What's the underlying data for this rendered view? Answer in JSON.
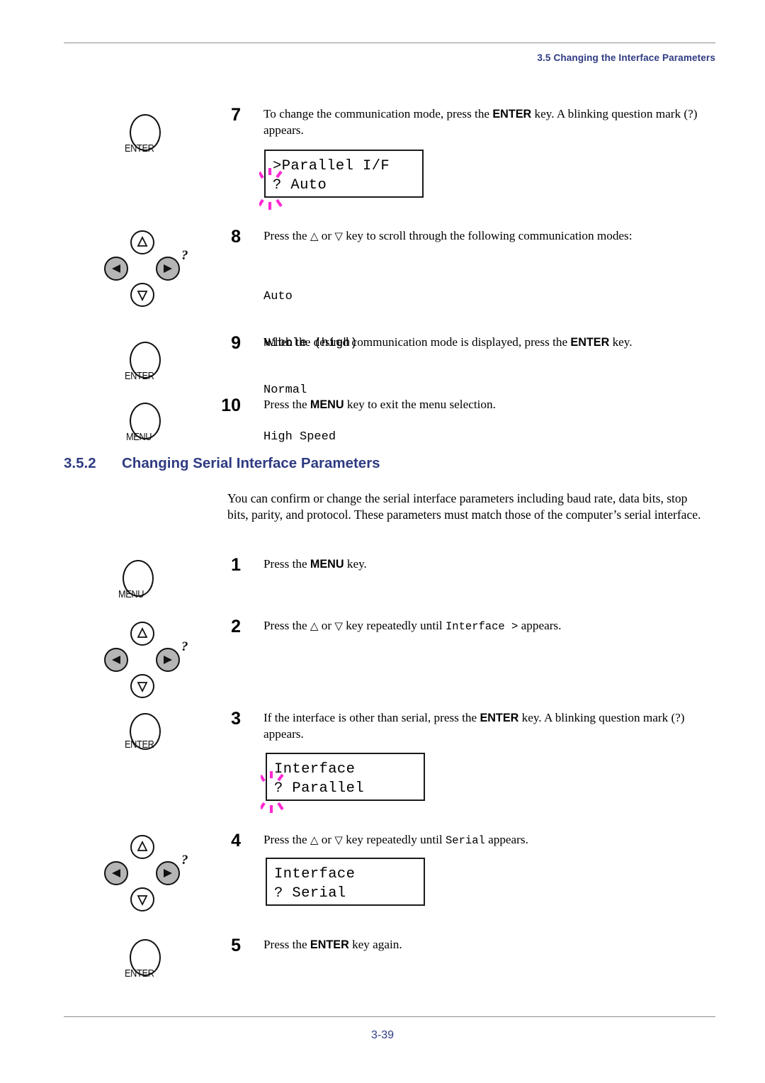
{
  "header": {
    "title": "3.5 Changing the Interface Parameters"
  },
  "footer": {
    "page_number": "3-39"
  },
  "section": {
    "number": "3.5.2",
    "title": "Changing Serial Interface Parameters",
    "intro": "You can confirm or change the serial interface parameters including baud rate, data bits, stop bits, parity, and protocol. These parameters must match those of the computer’s serial interface."
  },
  "key_icons": {
    "enter_label": "ENTER",
    "menu_label": "MENU",
    "question_mark": "?"
  },
  "colors": {
    "heading_navy": "#2e3b82",
    "blink_magenta": "#ff2ad4",
    "rule_gray": "#8d8d8d",
    "key_fill_gray": "#b5b5b5"
  },
  "steps": [
    {
      "number": "7",
      "text_html": "To change the communication mode, press the <b>ENTER</b> key. A blinking question mark (?) appears."
    },
    {
      "number": "8",
      "text_html": "Press the <span class=\"tri\">△</span> or <span class=\"tri\">▽</span> key to scroll through the following communication modes:"
    },
    {
      "number": "9",
      "text_html": "When the desired communication mode is displayed, press the <b>ENTER</b> key."
    },
    {
      "number": "10",
      "text_html": "Press the <b>MENU</b> key to exit the menu selection."
    },
    {
      "number": "1",
      "text_html": "Press the <b>MENU</b> key."
    },
    {
      "number": "2",
      "text_html": "Press the <span class=\"tri\">△</span> or <span class=\"tri\">▽</span> key repeatedly until <span class=\"mono\">Interface &gt;</span> appears."
    },
    {
      "number": "3",
      "text_html": "If the interface is other than serial, press the <b>ENTER</b> key. A blinking question mark (?) appears."
    },
    {
      "number": "4",
      "text_html": "Press the <span class=\"tri\">△</span> or <span class=\"tri\">▽</span> key repeatedly until <span class=\"mono\">Serial</span> appears."
    },
    {
      "number": "5",
      "text_html": "Press the <b>ENTER</b> key again."
    }
  ],
  "communication_modes": [
    "Auto",
    "Nibble (high)",
    "Normal",
    "High Speed"
  ],
  "lcd_displays": [
    {
      "name": "parallel-if-auto",
      "line1": ">Parallel I/F",
      "line2": "? Auto",
      "blinking": true
    },
    {
      "name": "interface-parallel",
      "line1": "Interface",
      "line2": "? Parallel",
      "blinking": true
    },
    {
      "name": "interface-serial",
      "line1": "Interface",
      "line2": "? Serial",
      "blinking": false
    }
  ]
}
